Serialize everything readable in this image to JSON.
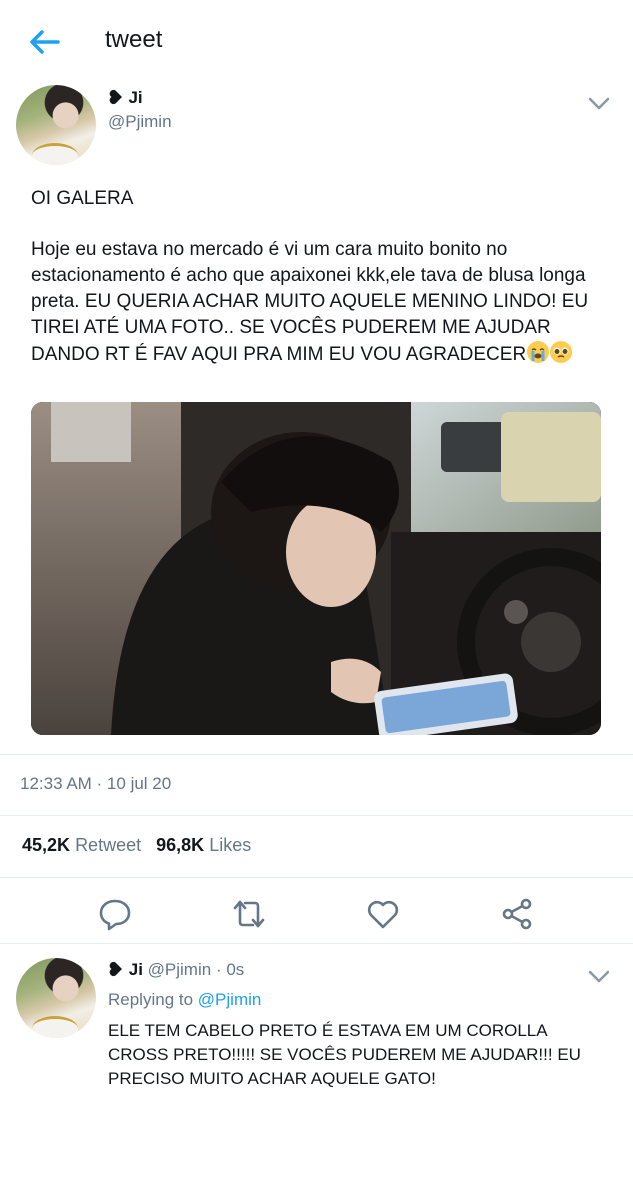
{
  "header": {
    "title": "tweet"
  },
  "tweet": {
    "author_name": "Ji",
    "author_handle": "@Pjimin",
    "text_line1": "OI GALERA",
    "text_body": "Hoje eu estava no mercado é vi um cara muito bonito no estacionamento é acho que apaixonei kkk,ele tava de blusa longa preta. EU QUERIA ACHAR MUITO AQUELE MENINO LINDO! EU TIREI ATÉ UMA FOTO.. SE VOCÊS PUDEREM ME AJUDAR DANDO RT É FAV AQUI PRA MIM EU VOU AGRADECER",
    "emojis": [
      "loudly-crying-face",
      "pleading-face"
    ],
    "timestamp": "12:33 AM · 10 jul 20",
    "retweets_count": "45,2K",
    "retweets_label": "Retweet",
    "likes_count": "96,8K",
    "likes_label": "Likes"
  },
  "actions": [
    "reply-icon",
    "retweet-icon",
    "like-icon",
    "share-icon"
  ],
  "reply": {
    "author_name": "Ji",
    "author_handle": "@Pjimin",
    "time": "· 0s",
    "replying_prefix": "Replying to",
    "replying_to": "@Pjimin",
    "text": "ELE TEM CABELO PRETO É ESTAVA EM UM COROLLA CROSS PRETO!!!!! SE VOCÊS PUDEREM ME AJUDAR!!! EU PRECISO MUITO ACHAR AQUELE GATO!"
  },
  "colors": {
    "accent": "#1da1f2",
    "secondary_text": "#657786",
    "divider": "#e6ecf0"
  }
}
